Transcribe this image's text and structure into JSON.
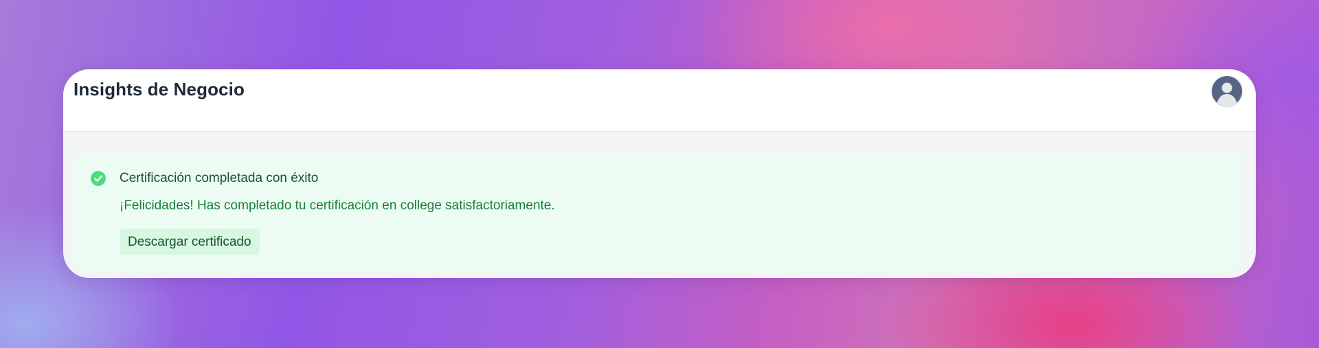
{
  "header": {
    "title": "Insights de Negocio",
    "avatar_icon": "user-avatar-icon"
  },
  "alert": {
    "icon": "check-circle-icon",
    "status": "success",
    "title": "Certificación completada con éxito",
    "message": "¡Felicidades! Has completado tu certificación en college satisfactoriamente.",
    "action_label": "Descargar certificado"
  },
  "colors": {
    "success_icon": "#4ade80",
    "alert_background": "#edfcf2",
    "button_background": "#d8f7e2",
    "title_text": "#14532d",
    "message_text": "#15803d",
    "avatar_background": "#566583"
  }
}
